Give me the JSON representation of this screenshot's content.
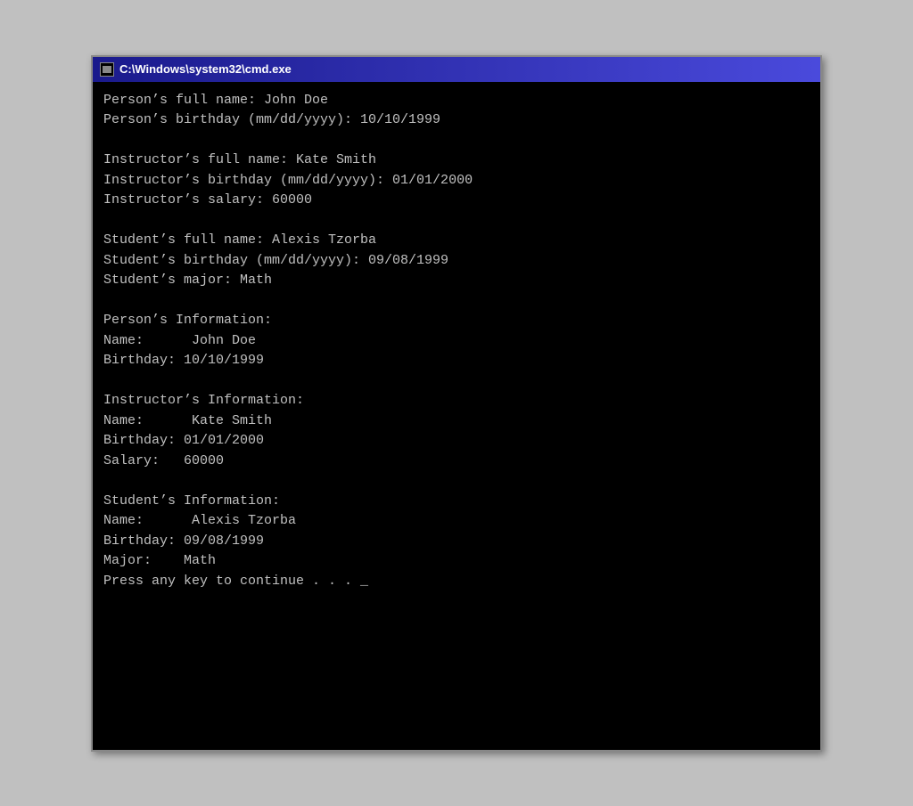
{
  "window": {
    "title": "C:\\Windows\\system32\\cmd.exe",
    "icon_label": "cmd-icon"
  },
  "console": {
    "lines": [
      "Person’s full name: John Doe",
      "Person’s birthday (mm/dd/yyyy): 10/10/1999",
      "",
      "Instructor’s full name: Kate Smith",
      "Instructor’s birthday (mm/dd/yyyy): 01/01/2000",
      "Instructor’s salary: 60000",
      "",
      "Student’s full name: Alexis Tzorba",
      "Student’s birthday (mm/dd/yyyy): 09/08/1999",
      "Student’s major: Math",
      "",
      "Person’s Information:",
      "Name:      John Doe",
      "Birthday: 10/10/1999",
      "",
      "Instructor’s Information:",
      "Name:      Kate Smith",
      "Birthday: 01/01/2000",
      "Salary:   60000",
      "",
      "Student’s Information:",
      "Name:      Alexis Tzorba",
      "Birthday: 09/08/1999",
      "Major:    Math",
      "Press any key to continue . . . _"
    ]
  }
}
